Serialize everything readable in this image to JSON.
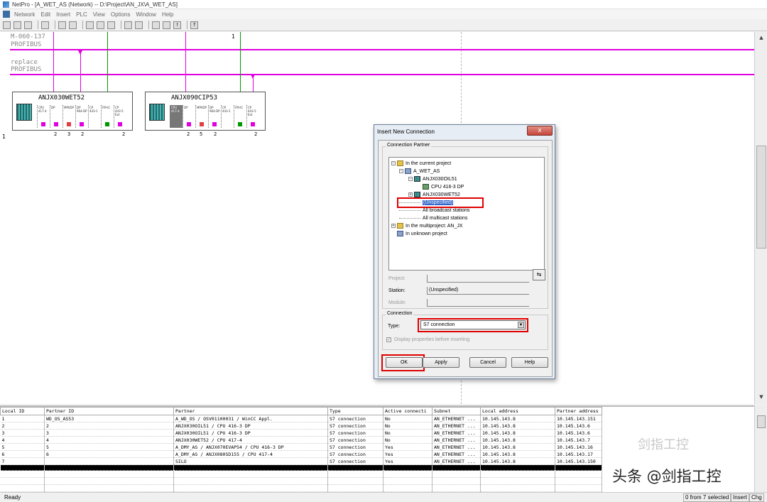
{
  "window": {
    "title": "NetPro - [A_WET_AS (Network) -- D:\\Project\\AN_JX\\A_WET_AS]"
  },
  "menu": [
    "Network",
    "Edit",
    "Insert",
    "PLC",
    "View",
    "Options",
    "Window",
    "Help"
  ],
  "canvas": {
    "bus1_name": "M-060-137",
    "bus1_type": "PROFIBUS",
    "bus2_name": "replace",
    "bus2_type": "PROFIBUS",
    "ruler_num": "1",
    "row_num": "1",
    "stations": [
      {
        "name": "ANJX030WET52",
        "modules": [
          "CPU 417-4",
          "DP",
          "MPI/DP",
          "DP 964-DP",
          "CP 443-1",
          "FM-IC",
          "CP 443-5 Ext"
        ],
        "port_colors": [
          "#e000e0",
          "#e000e0",
          "#e04040",
          "#e000e0",
          "",
          "#009a00",
          "#e000e0"
        ],
        "addresses": [
          "2",
          "3",
          "2",
          "2"
        ]
      },
      {
        "name": "ANJX090CIP53",
        "modules": [
          "CPU 417-4",
          "DP",
          "MPI/DP",
          "DP 964-DP",
          "CP 443-1",
          "FM-IC",
          "CP 443-5 Ext"
        ],
        "port_colors": [
          "",
          "#e000e0",
          "#e04040",
          "#e000e0",
          "",
          "#009a00",
          "#e000e0"
        ],
        "addresses": [
          "2",
          "5",
          "2",
          "2"
        ]
      }
    ]
  },
  "dialog": {
    "title": "Insert New Connection",
    "close_label": "x",
    "group_partner": "Connection Partner",
    "tree": [
      {
        "label": "In the current project",
        "icon": "folder-icon"
      },
      {
        "label": "A_WET_AS",
        "icon": "project-icon"
      },
      {
        "label": "ANJX030OIL51",
        "icon": "station-icon"
      },
      {
        "label": "CPU 416-3 DP",
        "icon": "cpu-icon"
      },
      {
        "label": "ANJX030WET52",
        "icon": "station-icon"
      },
      {
        "label": "(Unspecified)",
        "icon": ""
      },
      {
        "label": "All broadcast stations",
        "icon": ""
      },
      {
        "label": "All multicast stations",
        "icon": ""
      },
      {
        "label": "In the multiproject: AN_JX",
        "icon": "folder-icon"
      },
      {
        "label": "In unknown project",
        "icon": "project-icon"
      }
    ],
    "project_label": "Project:",
    "project_value": "",
    "station_label": "Station:",
    "station_value": "(Unspecified)",
    "module_label": "Module:",
    "module_value": "",
    "group_connection": "Connection",
    "type_label": "Type:",
    "type_value": "S7 connection",
    "display_props_label": "Display properties before inserting",
    "buttons": {
      "ok": "OK",
      "apply": "Apply",
      "cancel": "Cancel",
      "help": "Help"
    }
  },
  "table": {
    "headers": [
      "Local ID",
      "Partner ID",
      "Partner",
      "Type",
      "Active connecti",
      "Subnet",
      "Local address",
      "Partner address"
    ],
    "rows": [
      [
        "1",
        "WD_OS_AS53",
        "A_WD_OS / OSV01100031 / WinCC Appl.",
        "S7 connection",
        "No",
        "AN_ETHERNET ...",
        "10.145.143.8",
        "10.145.143.151"
      ],
      [
        "2",
        "2",
        "ANJX030OIL51 / CPU 416-3 DP",
        "S7 connection",
        "No",
        "AN_ETHERNET ...",
        "10.145.143.8",
        "10.145.143.6"
      ],
      [
        "3",
        "3",
        "ANJX030OIL51 / CPU 416-3 DP",
        "S7 connection",
        "No",
        "AN_ETHERNET ...",
        "10.145.143.8",
        "10.145.143.6"
      ],
      [
        "4",
        "4",
        "ANJX030WET52 / CPU 417-4",
        "S7 connection",
        "No",
        "AN_ETHERNET ...",
        "10.145.143.8",
        "10.145.143.7"
      ],
      [
        "5",
        "5",
        "A_DMY_AS / ANJX070EVAP54 / CPU 416-3 DP",
        "S7 connection",
        "Yes",
        "AN_ETHERNET ...",
        "10.145.143.8",
        "10.145.143.16"
      ],
      [
        "6",
        "6",
        "A_DMY_AS / ANJX080SD155 / CPU 417-4",
        "S7 connection",
        "Yes",
        "AN_ETHERNET ...",
        "10.145.143.8",
        "10.145.143.17"
      ],
      [
        "7",
        "",
        "SILO",
        "S7 connection",
        "Yes",
        "AN_ETHERNET ...",
        "10.145.143.8",
        "10.145.143.150"
      ]
    ]
  },
  "status": {
    "left": "Ready",
    "selection": "0 from 7 selected",
    "mode": "Insert",
    "chg": "Chg"
  },
  "watermark": {
    "main": "头条 @剑指工控",
    "faint": "剑指工控"
  }
}
